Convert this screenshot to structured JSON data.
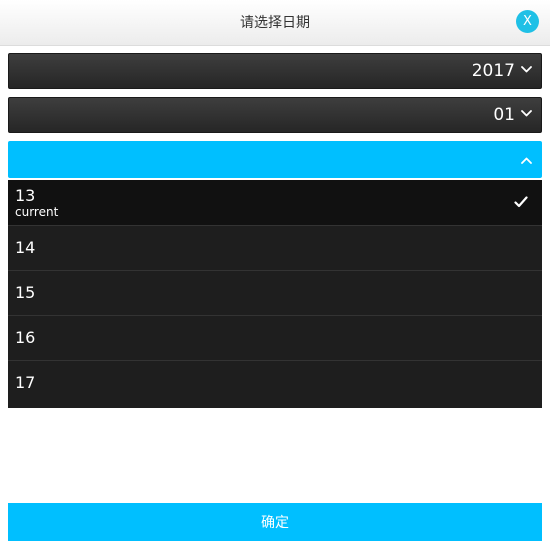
{
  "dialog": {
    "title": "请选择日期",
    "close_label": "X"
  },
  "year_select": {
    "value": "2017",
    "icon": "chevron-down-icon"
  },
  "month_select": {
    "value": "01",
    "icon": "chevron-down-icon"
  },
  "day_select": {
    "value": "",
    "icon": "chevron-up-icon",
    "expanded": true
  },
  "day_options": [
    {
      "label": "13",
      "sublabel": "current",
      "selected": true
    },
    {
      "label": "14"
    },
    {
      "label": "15"
    },
    {
      "label": "16"
    },
    {
      "label": "17"
    }
  ],
  "confirm_button": {
    "label": "确定"
  },
  "colors": {
    "accent": "#00bfff",
    "close_button": "#1fc0e6",
    "select_background": "#2e2e2e",
    "list_background": "#1e1e1e",
    "selected_row_background": "#111111"
  }
}
